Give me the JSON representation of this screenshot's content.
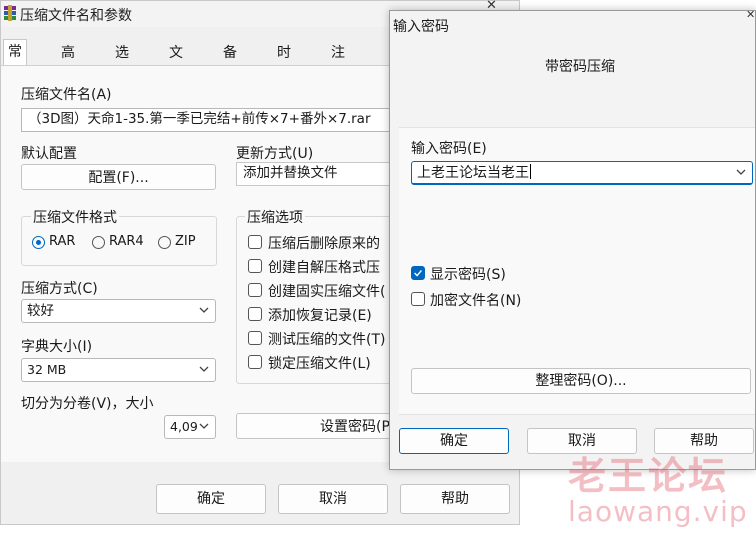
{
  "main_dialog": {
    "title": "压缩文件名和参数",
    "tabs": [
      "常规",
      "高级",
      "选项",
      "文件",
      "备份",
      "时间",
      "注释"
    ],
    "archive_name_label": "压缩文件名(A)",
    "archive_name_value": "（3D图）天命1-35.第一季已完结+前传×7+番外×7.rar",
    "default_profile_label": "默认配置",
    "profile_button": "配置(F)...",
    "update_mode_label": "更新方式(U)",
    "update_mode_value": "添加并替换文件",
    "format_group_label": "压缩文件格式",
    "formats": [
      {
        "label": "RAR",
        "selected": true
      },
      {
        "label": "RAR4",
        "selected": false
      },
      {
        "label": "ZIP",
        "selected": false
      }
    ],
    "method_label": "压缩方式(C)",
    "method_value": "较好",
    "dict_label": "字典大小(I)",
    "dict_value": "32 MB",
    "volume_label": "切分为分卷(V)，大小",
    "volume_value": "4,09",
    "options_group_label": "压缩选项",
    "options": [
      {
        "label": "压缩后删除原来的",
        "checked": false
      },
      {
        "label": "创建自解压格式压",
        "checked": false
      },
      {
        "label": "创建固实压缩文件(",
        "checked": false
      },
      {
        "label": "添加恢复记录(E)",
        "checked": false
      },
      {
        "label": "测试压缩的文件(T)",
        "checked": false
      },
      {
        "label": "锁定压缩文件(L)",
        "checked": false
      }
    ],
    "set_password_button": "设置密码(P",
    "ok_button": "确定",
    "cancel_button": "取消",
    "help_button": "帮助"
  },
  "password_dialog": {
    "title": "输入密码",
    "header": "带密码压缩",
    "password_label": "输入密码(E)",
    "password_value": "上老王论坛当老王",
    "show_password_label": "显示密码(S)",
    "show_password_checked": true,
    "encrypt_names_label": "加密文件名(N)",
    "encrypt_names_checked": false,
    "organize_button": "整理密码(O)...",
    "ok_button": "确定",
    "cancel_button": "取消",
    "help_button": "帮助"
  },
  "watermark": {
    "line1": "老王论坛",
    "line2": "laowang.vip"
  },
  "colors": {
    "accent": "#0067c0",
    "watermark": "#e0465a"
  }
}
